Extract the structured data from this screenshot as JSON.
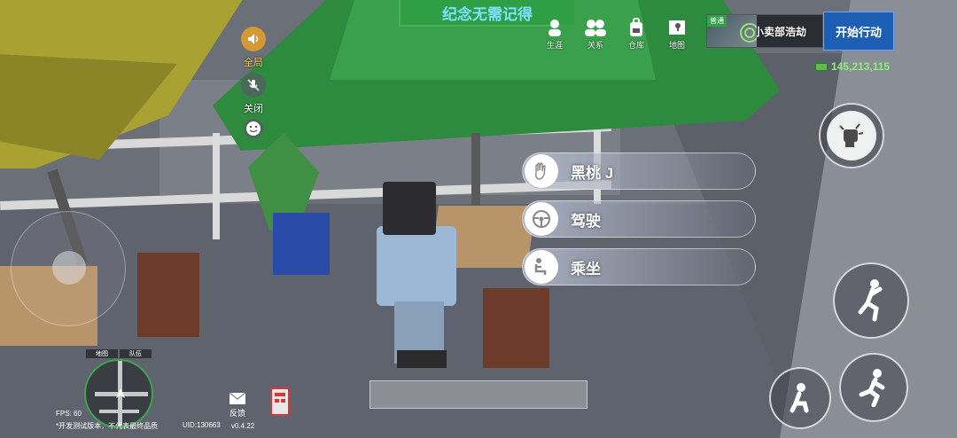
{
  "hud": {
    "banner_text": "纪念无需记得",
    "top_menu": [
      {
        "label": "生涯",
        "icon": "person-icon"
      },
      {
        "label": "关系",
        "icon": "people-icon"
      },
      {
        "label": "仓库",
        "icon": "backpack-icon"
      },
      {
        "label": "地图",
        "icon": "map-icon"
      }
    ],
    "event": {
      "tag": "普通",
      "name": "小卖部浩劫",
      "start_label": "开始行动"
    },
    "money": "145,213,115",
    "audio": {
      "global_label": "全局",
      "mic_label": "关闭"
    },
    "actions": [
      {
        "label": "黑桃 J",
        "icon": "wave-hand-icon"
      },
      {
        "label": "驾驶",
        "icon": "steering-wheel-icon"
      },
      {
        "label": "乘坐",
        "icon": "seat-icon"
      }
    ],
    "minimap_tabs": [
      "地图",
      "队伍"
    ],
    "fps": "FPS: 60",
    "dev_note": "*开发测试版本，不代表最终品质",
    "uid": "UID:130663",
    "version": "v0.4.22",
    "feedback_label": "反馈"
  },
  "colors": {
    "accent_green": "#2f9e44",
    "start_blue": "#1d5fb3",
    "money_green": "#8ff078"
  }
}
